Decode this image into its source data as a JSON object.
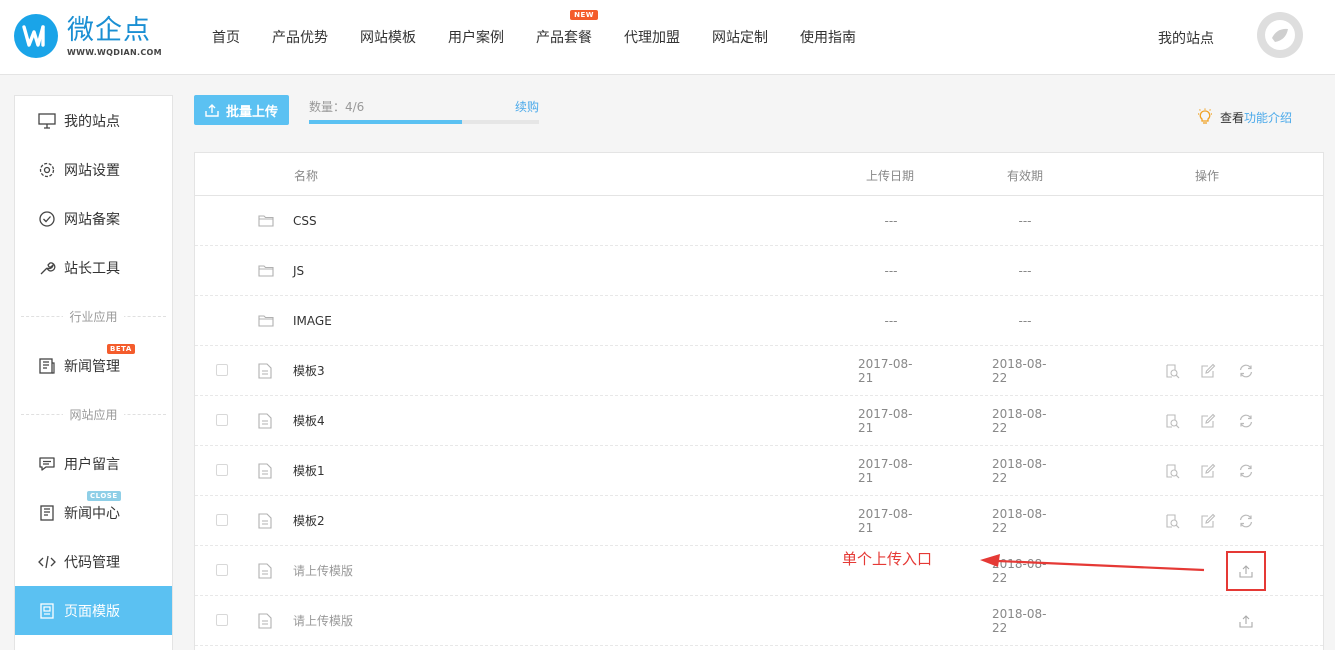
{
  "app": {
    "logo_name": "微企点",
    "logo_sub": "WWW.WQDIAN.COM"
  },
  "nav": {
    "items": [
      {
        "label": "首页"
      },
      {
        "label": "产品优势"
      },
      {
        "label": "网站模板"
      },
      {
        "label": "用户案例"
      },
      {
        "label": "产品套餐",
        "badge": "NEW"
      },
      {
        "label": "代理加盟"
      },
      {
        "label": "网站定制"
      },
      {
        "label": "使用指南"
      }
    ],
    "my_sites": "我的站点"
  },
  "sidebar": {
    "items": [
      {
        "label": "我的站点",
        "icon": "monitor-icon"
      },
      {
        "label": "网站设置",
        "icon": "gear-icon"
      },
      {
        "label": "网站备案",
        "icon": "check-circle-icon"
      },
      {
        "label": "站长工具",
        "icon": "wrench-icon"
      }
    ],
    "sep_industry": "行业应用",
    "news_manage": {
      "label": "新闻管理",
      "badge": "BETA",
      "icon": "newspaper-icon"
    },
    "sep_site": "网站应用",
    "site_items": [
      {
        "label": "用户留言",
        "icon": "message-icon"
      },
      {
        "label": "新闻中心",
        "badge": "CLOSE",
        "icon": "news-icon"
      },
      {
        "label": "代码管理",
        "icon": "code-icon"
      },
      {
        "label": "页面模版",
        "icon": "template-icon",
        "active": true
      }
    ]
  },
  "toolbar": {
    "upload_label": "批量上传",
    "quota_label": "数量：4/6",
    "quota_fraction": 0.667,
    "renew_label": "续购",
    "intro_prefix": "查看",
    "intro_link": "功能介绍"
  },
  "table": {
    "headers": {
      "name": "名称",
      "date": "上传日期",
      "valid": "有效期",
      "actions": "操作"
    },
    "folders": [
      {
        "name": "CSS",
        "date": "---",
        "valid": "---"
      },
      {
        "name": "JS",
        "date": "---",
        "valid": "---"
      },
      {
        "name": "IMAGE",
        "date": "---",
        "valid": "---"
      }
    ],
    "files": [
      {
        "name": "模板3",
        "date": "2017-08-21",
        "valid": "2018-08-22"
      },
      {
        "name": "模板4",
        "date": "2017-08-21",
        "valid": "2018-08-22"
      },
      {
        "name": "模板1",
        "date": "2017-08-21",
        "valid": "2018-08-22"
      },
      {
        "name": "模板2",
        "date": "2017-08-21",
        "valid": "2018-08-22"
      }
    ],
    "empty_slots": [
      {
        "name": "请上传模版",
        "valid": "2018-08-22"
      },
      {
        "name": "请上传模版",
        "valid": "2018-08-22"
      }
    ]
  },
  "annotation": {
    "text": "单个上传入口",
    "color": "#e53935"
  },
  "colors": {
    "accent": "#5bc1f2",
    "brand": "#1aa4e8",
    "link": "#4aa9ea",
    "badge_new": "#f45c2c"
  }
}
